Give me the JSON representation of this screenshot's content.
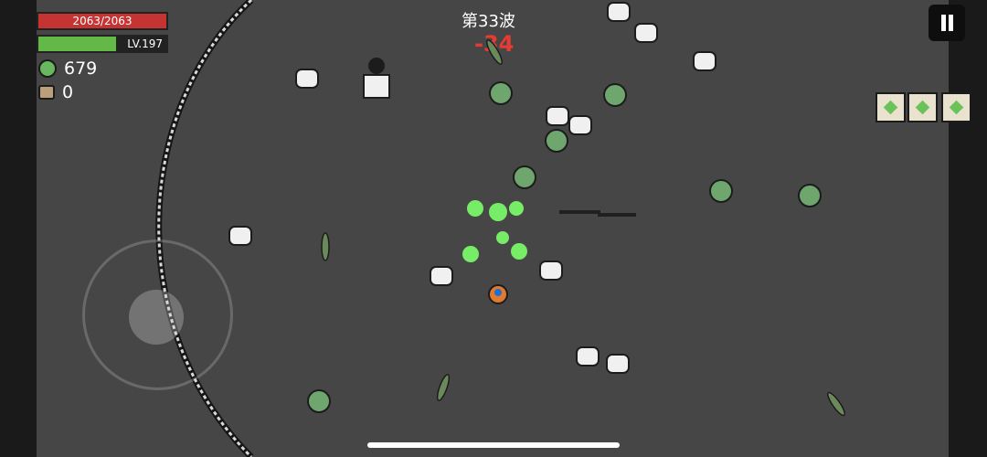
{
  "hud": {
    "hp_text": "2063/2063",
    "level_text": "LV.197",
    "gems": "679",
    "bags": "0",
    "wave": "第33波",
    "damage": "-34"
  }
}
